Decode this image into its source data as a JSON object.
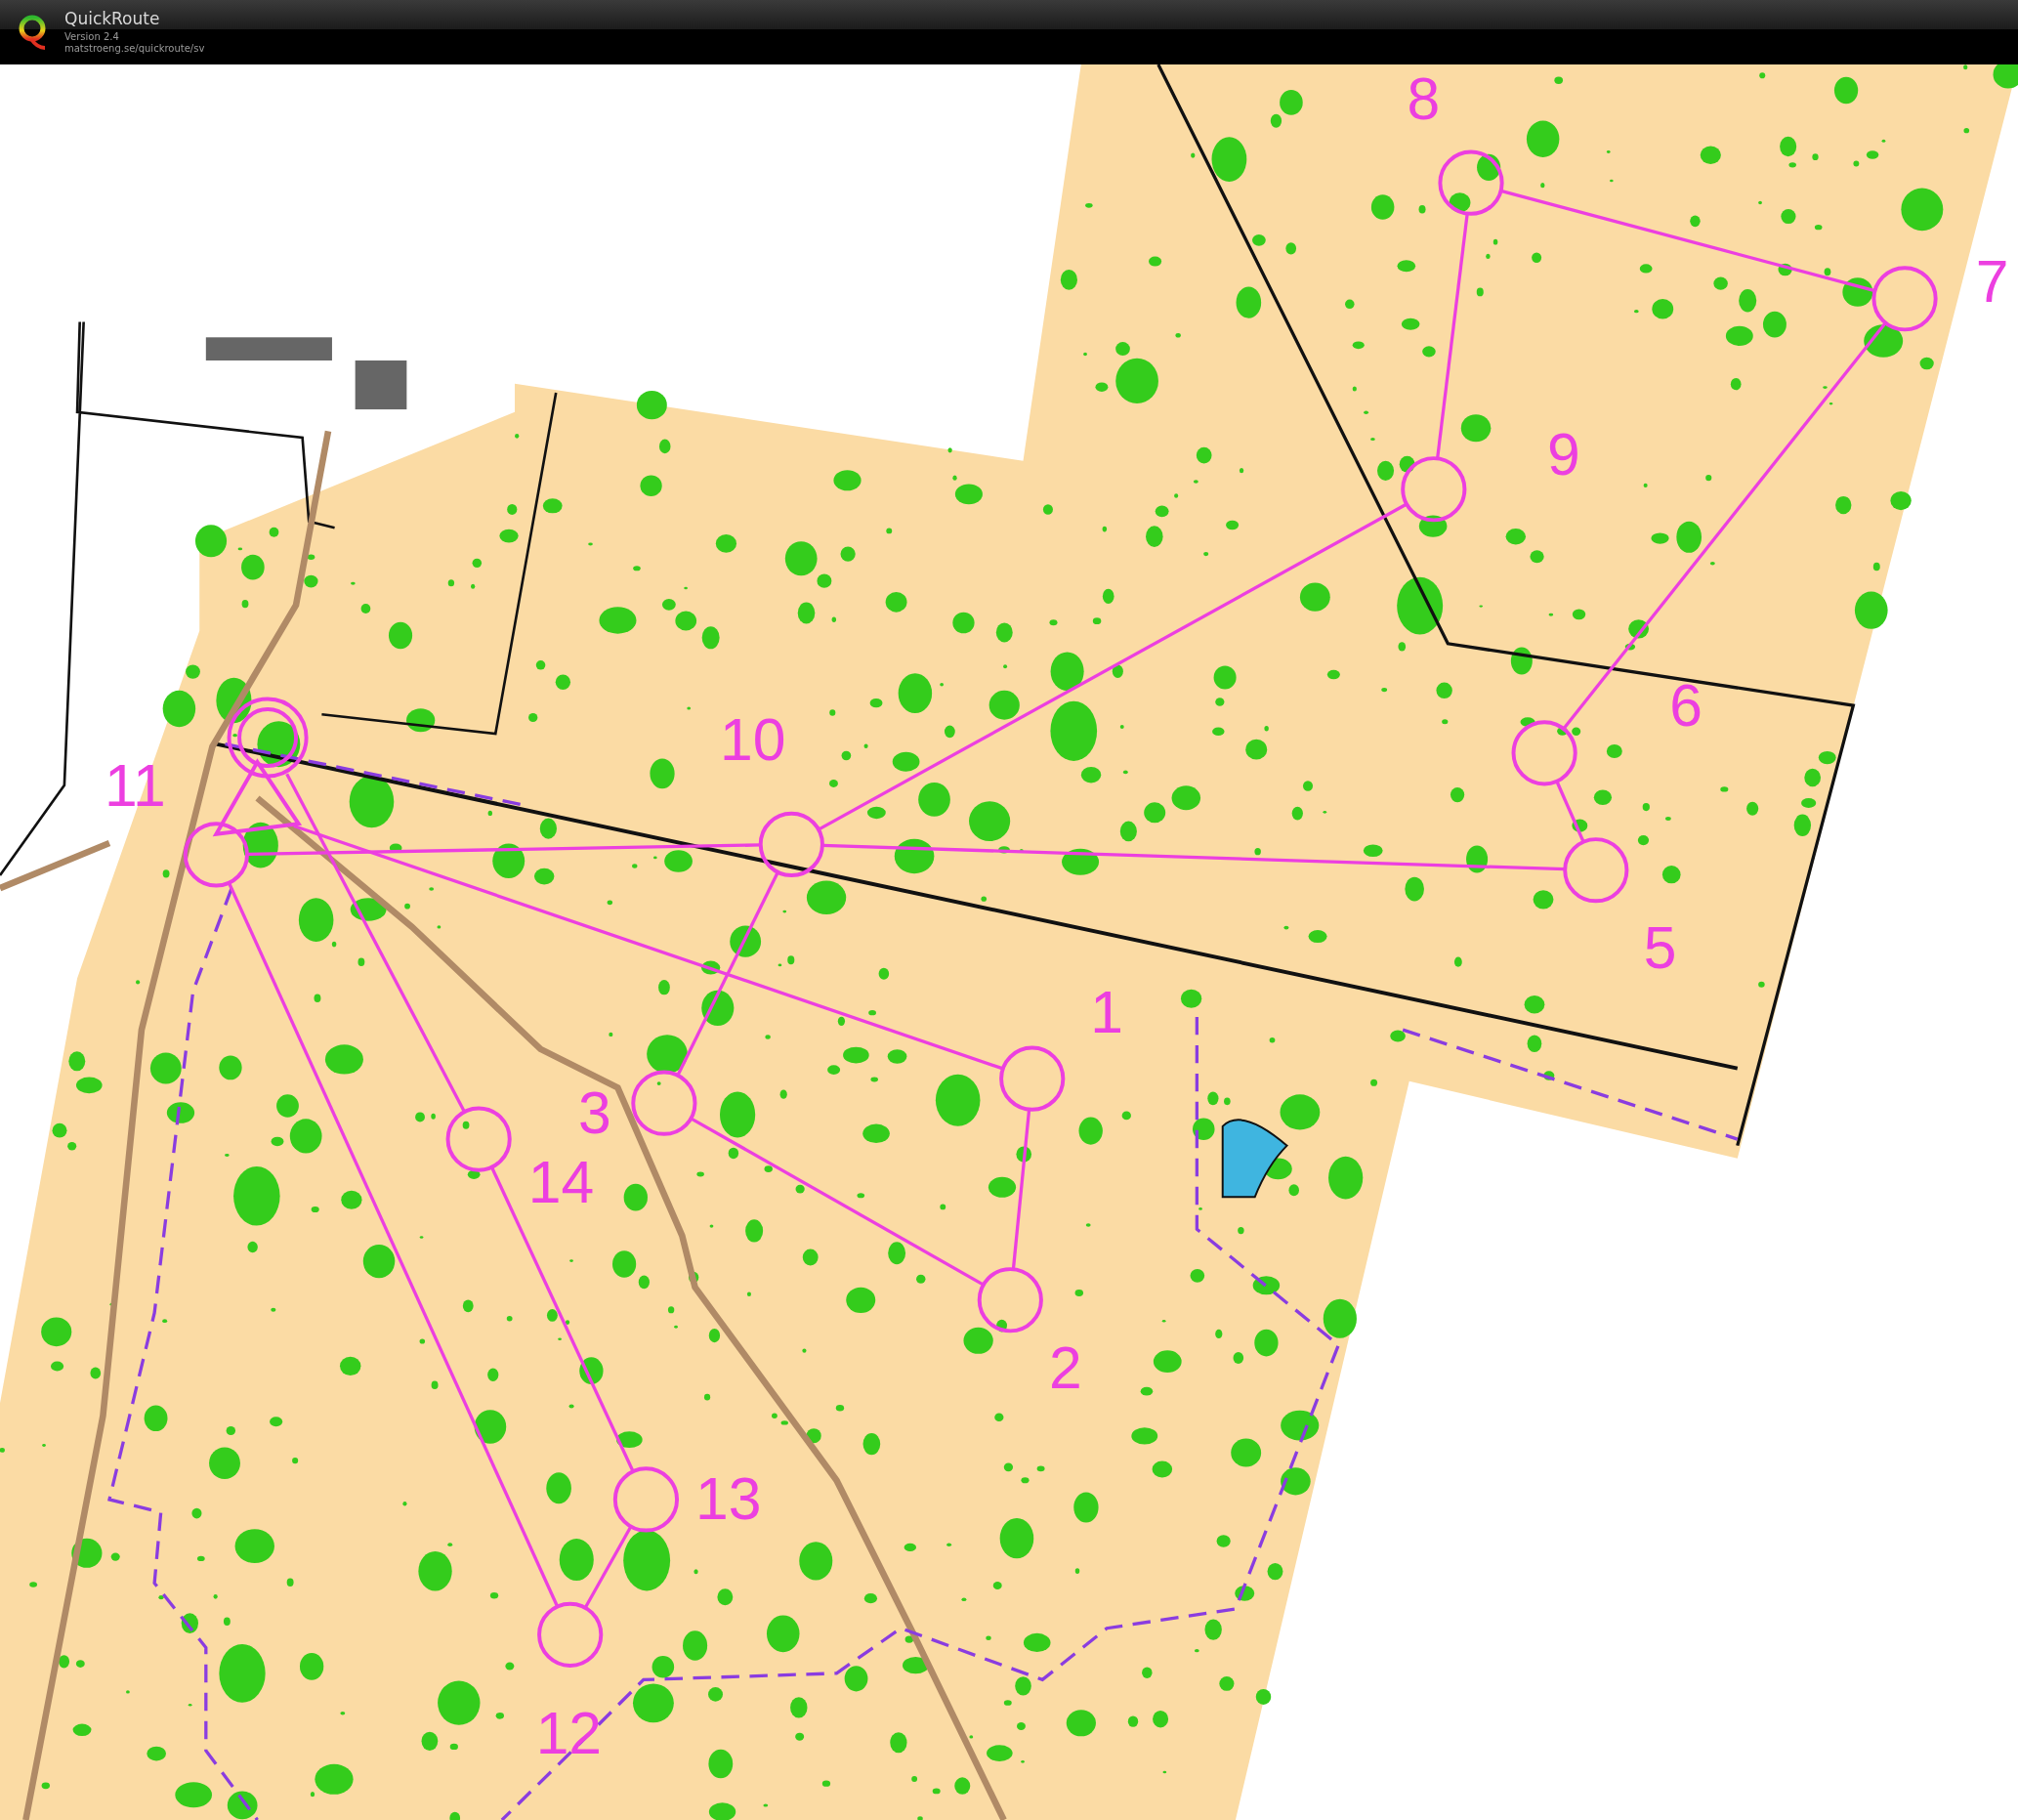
{
  "app": {
    "title": "QuickRoute",
    "version": "Version 2.4",
    "url": "matstroeng.se/quickroute/sv"
  },
  "controls": [
    {
      "label": "1"
    },
    {
      "label": "2"
    },
    {
      "label": "3"
    },
    {
      "label": "5"
    },
    {
      "label": "6"
    },
    {
      "label": "7"
    },
    {
      "label": "8"
    },
    {
      "label": "9"
    },
    {
      "label": "10"
    },
    {
      "label": "11"
    },
    {
      "label": "12"
    },
    {
      "label": "13"
    },
    {
      "label": "14"
    }
  ]
}
